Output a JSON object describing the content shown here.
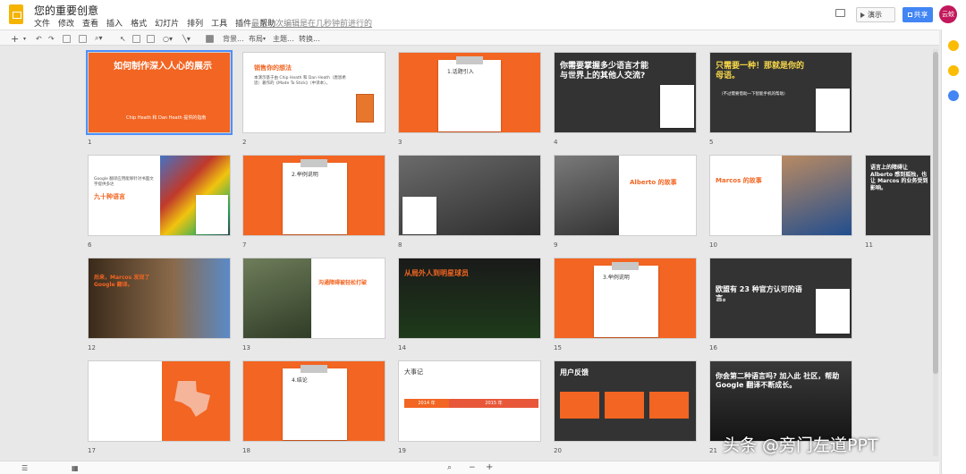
{
  "app": {
    "title": "您的重要创意",
    "menu": [
      "文件",
      "修改",
      "查看",
      "插入",
      "格式",
      "幻灯片",
      "排列",
      "工具",
      "插件",
      "帮助"
    ],
    "last_edit": "最近一次编辑是在几秒钟前进行的",
    "present_label": "演示",
    "share_label": "共享",
    "avatar_label": "云蛟"
  },
  "toolbar": {
    "background": "背景...",
    "layout": "布局",
    "theme": "主题...",
    "transition": "转换..."
  },
  "colors": {
    "accent": "#f26522",
    "dark": "#333333",
    "selected": "#4d90fe",
    "share": "#4285f4"
  },
  "slides": [
    {
      "num": "1",
      "title": "如何制作深入人心的展示",
      "caption": "Chip Heath 和 Dan Heath 提供的指南"
    },
    {
      "num": "2",
      "title": "销售你的想法",
      "body": "本演示基于由 Chip Heath 和 Dan Heath（唐恩希思）著作的《Made To Stick》（中译本）。"
    },
    {
      "num": "3",
      "title": "1.话题引入"
    },
    {
      "num": "4",
      "title": "你需要掌握多少语言才能与世界上的其他人交流?"
    },
    {
      "num": "5",
      "title": "只需要一种！那就是你的母语。",
      "sub": "（不过需要借助一下智能手机的帮助）"
    },
    {
      "num": "6",
      "title": "九十种语言",
      "body": "Google 翻译应用能够针对书面文字提供多达"
    },
    {
      "num": "7",
      "title": "2.举例说明"
    },
    {
      "num": "8",
      "title": ""
    },
    {
      "num": "9",
      "title": "Alberto 的故事"
    },
    {
      "num": "10",
      "title": "Marcos 的故事"
    },
    {
      "num": "11",
      "title": "语言上的障碍让 Alberto 感到孤独，也让 Marcos 的业务受到影响。"
    },
    {
      "num": "12",
      "title": "后来，Marcos 发现了 Google 翻译。"
    },
    {
      "num": "13",
      "title": "沟通障碍被轻松打破"
    },
    {
      "num": "14",
      "title": "从局外人到明星球员"
    },
    {
      "num": "15",
      "title": "3.举例说明"
    },
    {
      "num": "16",
      "title": "欧盟有 23 种官方认可的语言。"
    },
    {
      "num": "17",
      "title": ""
    },
    {
      "num": "18",
      "title": "4.结论"
    },
    {
      "num": "19",
      "title": "大事记",
      "tl_a": "2014 年",
      "tl_b": "2015 年"
    },
    {
      "num": "20",
      "title": "用户反馈"
    },
    {
      "num": "21",
      "title": "你会第二种语言吗? 加入此 社区，帮助 Google 翻译不断成长。"
    }
  ],
  "watermark": "头条 @旁门左道PPT"
}
